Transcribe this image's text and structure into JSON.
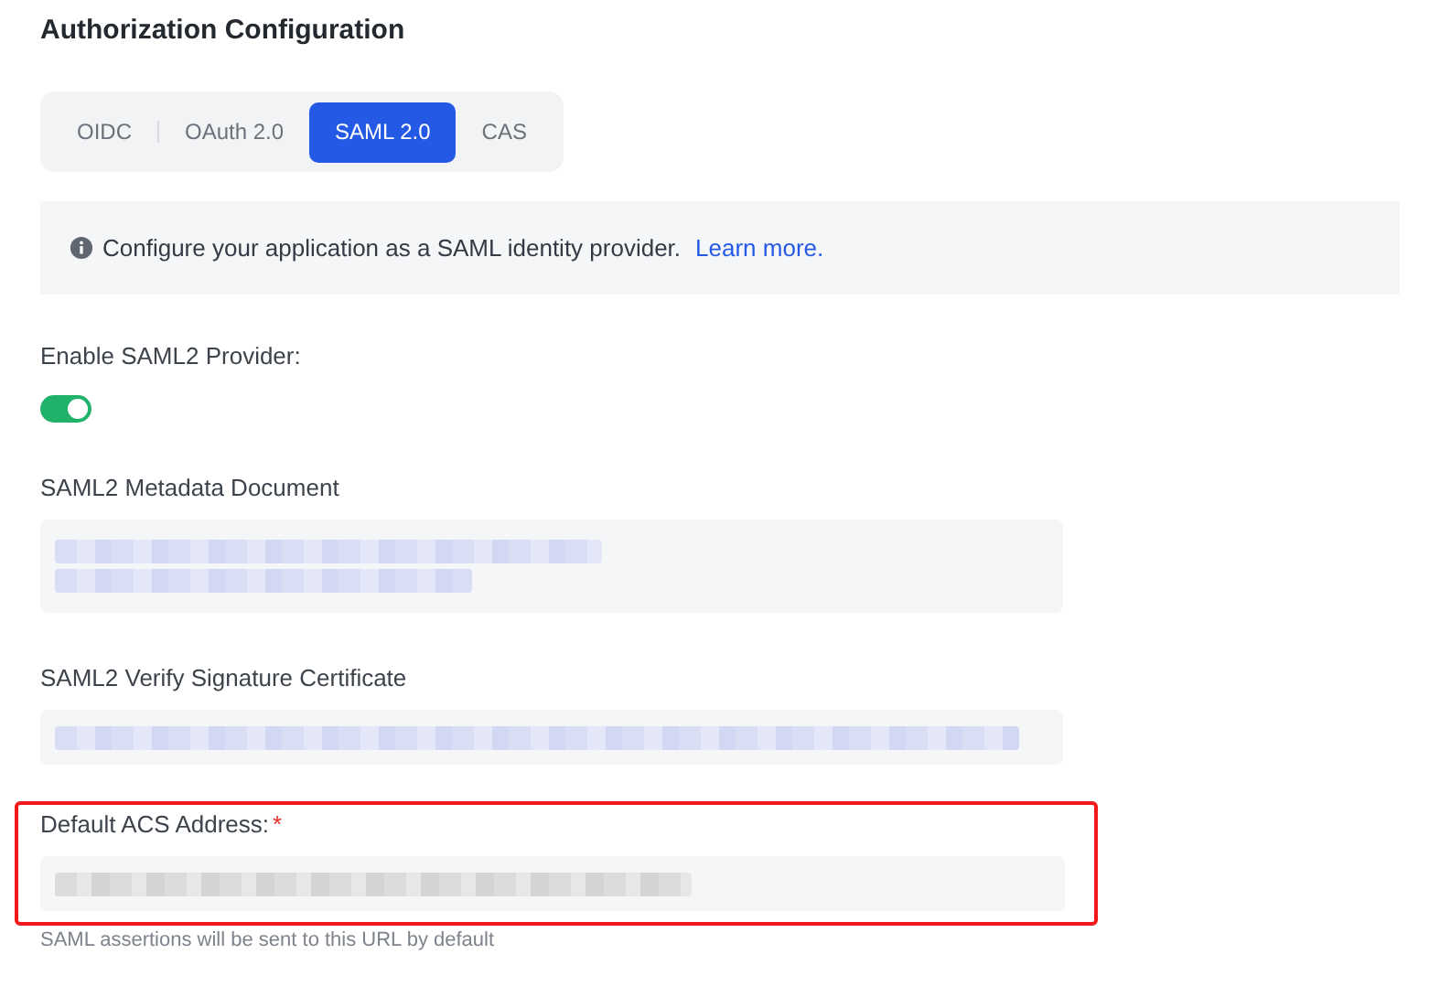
{
  "title": "Authorization Configuration",
  "tabs": [
    {
      "label": "OIDC",
      "selected": false
    },
    {
      "label": "OAuth 2.0",
      "selected": false
    },
    {
      "label": "SAML 2.0",
      "selected": true
    },
    {
      "label": "CAS",
      "selected": false
    }
  ],
  "info": {
    "text": "Configure your application as a SAML identity provider.",
    "link": "Learn more."
  },
  "enable": {
    "label": "Enable SAML2 Provider:",
    "on": true
  },
  "fields": [
    {
      "label": "SAML2 Metadata Document",
      "kind": "textarea",
      "highlighted": false
    },
    {
      "label": "SAML2 Verify Signature Certificate",
      "kind": "input",
      "highlighted": false
    },
    {
      "label": "Default ACS Address:",
      "kind": "input",
      "required_mark": "*",
      "highlighted": true,
      "help": "SAML assertions will be sent to this URL by default"
    }
  ]
}
